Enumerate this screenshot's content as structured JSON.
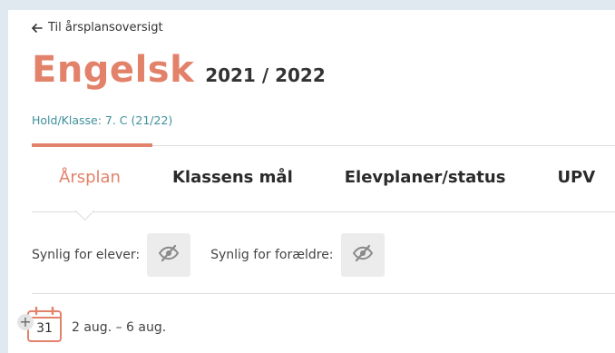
{
  "nav": {
    "back_label": "Til årsplansoversigt"
  },
  "header": {
    "subject": "Engelsk",
    "school_year": "2021 / 2022",
    "class_label": "Hold/Klasse: 7. C (21/22)"
  },
  "tabs": [
    {
      "label": "Årsplan",
      "active": true
    },
    {
      "label": "Klassens mål",
      "active": false
    },
    {
      "label": "Elevplaner/status",
      "active": false
    },
    {
      "label": "UPV",
      "active": false
    }
  ],
  "visibility": {
    "students_label": "Synlig for elever:",
    "parents_label": "Synlig for forældre:",
    "icon": "eye-slash-icon"
  },
  "week": {
    "add_symbol": "+",
    "number": "31",
    "dates": "2 aug. – 6 aug."
  },
  "colors": {
    "accent": "#e3826a",
    "teal": "#3f8f9a",
    "background": "#dfe9ef"
  }
}
